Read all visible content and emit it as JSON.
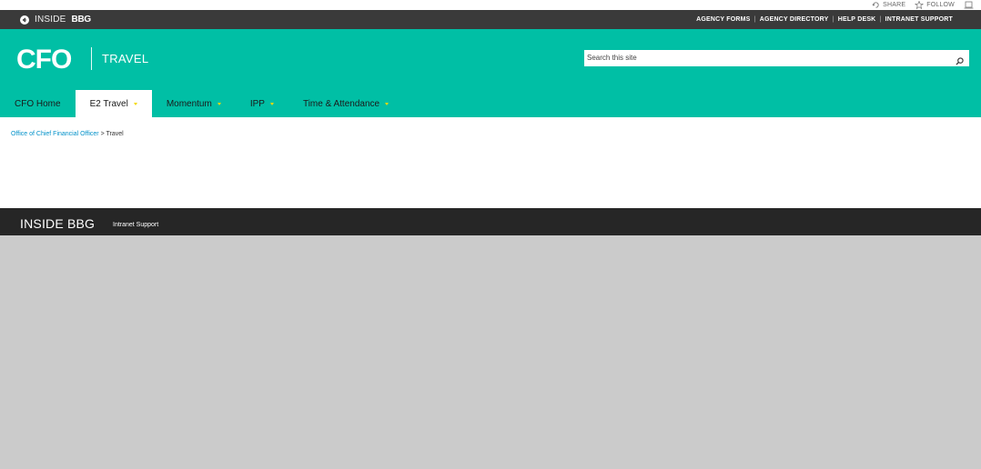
{
  "suite_bar": {
    "share_label": "SHARE",
    "follow_label": "FOLLOW"
  },
  "top_bar": {
    "inside_label": "INSIDE",
    "bbg_label": "BBG",
    "links": [
      "AGENCY FORMS",
      "AGENCY DIRECTORY",
      "HELP DESK",
      "INTRANET SUPPORT"
    ]
  },
  "header": {
    "logo": "CFO",
    "site_title": "TRAVEL",
    "search_placeholder": "Search this site"
  },
  "nav": {
    "items": [
      {
        "label": "CFO Home"
      },
      {
        "label": "E2 Travel"
      },
      {
        "label": "Momentum"
      },
      {
        "label": "IPP"
      },
      {
        "label": "Time & Attendance"
      }
    ]
  },
  "breadcrumb": {
    "parent": "Office of Chief Financial Officer",
    "separator": " > ",
    "current": "Travel"
  },
  "footer": {
    "brand": "INSIDE BBG",
    "link": "Intranet Support"
  },
  "colors": {
    "teal": "#00bfa5",
    "top_bar": "#3a3a3a",
    "footer": "#262626",
    "link_blue": "#0091c9",
    "caret_yellow": "#f3d900"
  }
}
